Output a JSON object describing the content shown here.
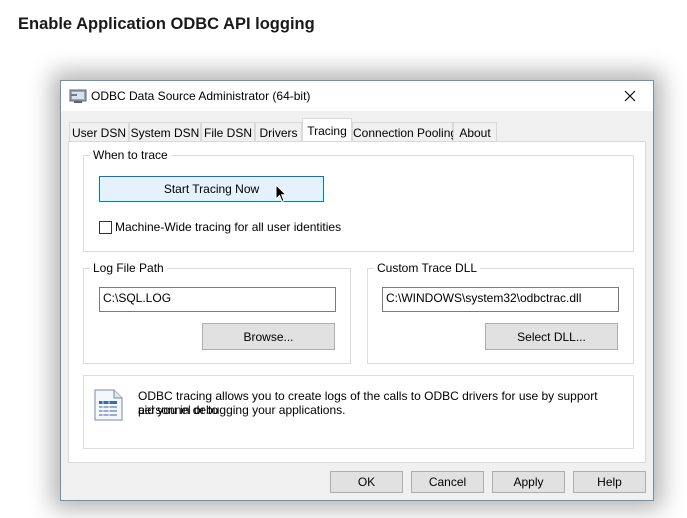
{
  "heading": "Enable Application ODBC API logging",
  "window": {
    "title": "ODBC Data Source Administrator (64-bit)",
    "icon": "odbc-admin-icon",
    "close_icon": "close-icon"
  },
  "tabs": [
    {
      "label": "User DSN"
    },
    {
      "label": "System DSN"
    },
    {
      "label": "File DSN"
    },
    {
      "label": "Drivers"
    },
    {
      "label": "Tracing",
      "active": true
    },
    {
      "label": "Connection Pooling"
    },
    {
      "label": "About"
    }
  ],
  "when_to_trace": {
    "label": "When to trace",
    "start_button": "Start Tracing Now",
    "machine_wide_label": "Machine-Wide tracing for all user identities",
    "machine_wide_checked": false
  },
  "log_file": {
    "label": "Log File Path",
    "value": "C:\\SQL.LOG",
    "browse_button": "Browse..."
  },
  "custom_dll": {
    "label": "Custom Trace DLL",
    "value": "C:\\WINDOWS\\system32\\odbctrac.dll",
    "select_button": "Select DLL..."
  },
  "info": {
    "icon": "document-icon",
    "line1": "ODBC tracing allows you to create logs of the calls to ODBC drivers for use by support personnel or to",
    "line2": "aid you in debugging your applications."
  },
  "footer": {
    "ok": "OK",
    "cancel": "Cancel",
    "apply": "Apply",
    "help": "Help"
  },
  "colors": {
    "primary_border": "#0078d7",
    "primary_fill": "#e5f1fb",
    "window_bg": "#f0f0f0"
  }
}
